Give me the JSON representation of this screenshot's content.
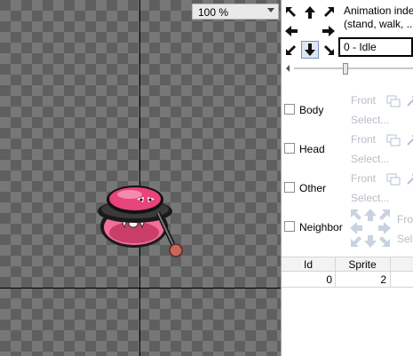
{
  "zoom": {
    "value": "100 %"
  },
  "animation": {
    "label_line1": "Animation inde",
    "label_line2": "(stand, walk, ...",
    "selected": "0 - Idle"
  },
  "directions": [
    "up-left-arrow-icon",
    "up-arrow-icon",
    "up-right-arrow-icon",
    "left-arrow-icon",
    "right-arrow-icon",
    "down-left-arrow-icon",
    "down-arrow-icon",
    "down-right-arrow-icon"
  ],
  "parts": [
    {
      "label": "Body",
      "front": "Front",
      "select": "Select..."
    },
    {
      "label": "Head",
      "front": "Front",
      "select": "Select..."
    },
    {
      "label": "Other",
      "front": "Front",
      "select": "Select..."
    },
    {
      "label": "Neighbor",
      "front": "Fron",
      "select": "Sele"
    }
  ],
  "table": {
    "headers": {
      "id": "Id",
      "sprite": "Sprite"
    },
    "rows": [
      {
        "id": "0",
        "sprite": "2"
      }
    ]
  },
  "colors": {
    "checker_dark": "#5f5f5f",
    "checker_light": "#777777",
    "disabled_text": "#b7bdc6",
    "sprite_pink": "#e8437a"
  }
}
